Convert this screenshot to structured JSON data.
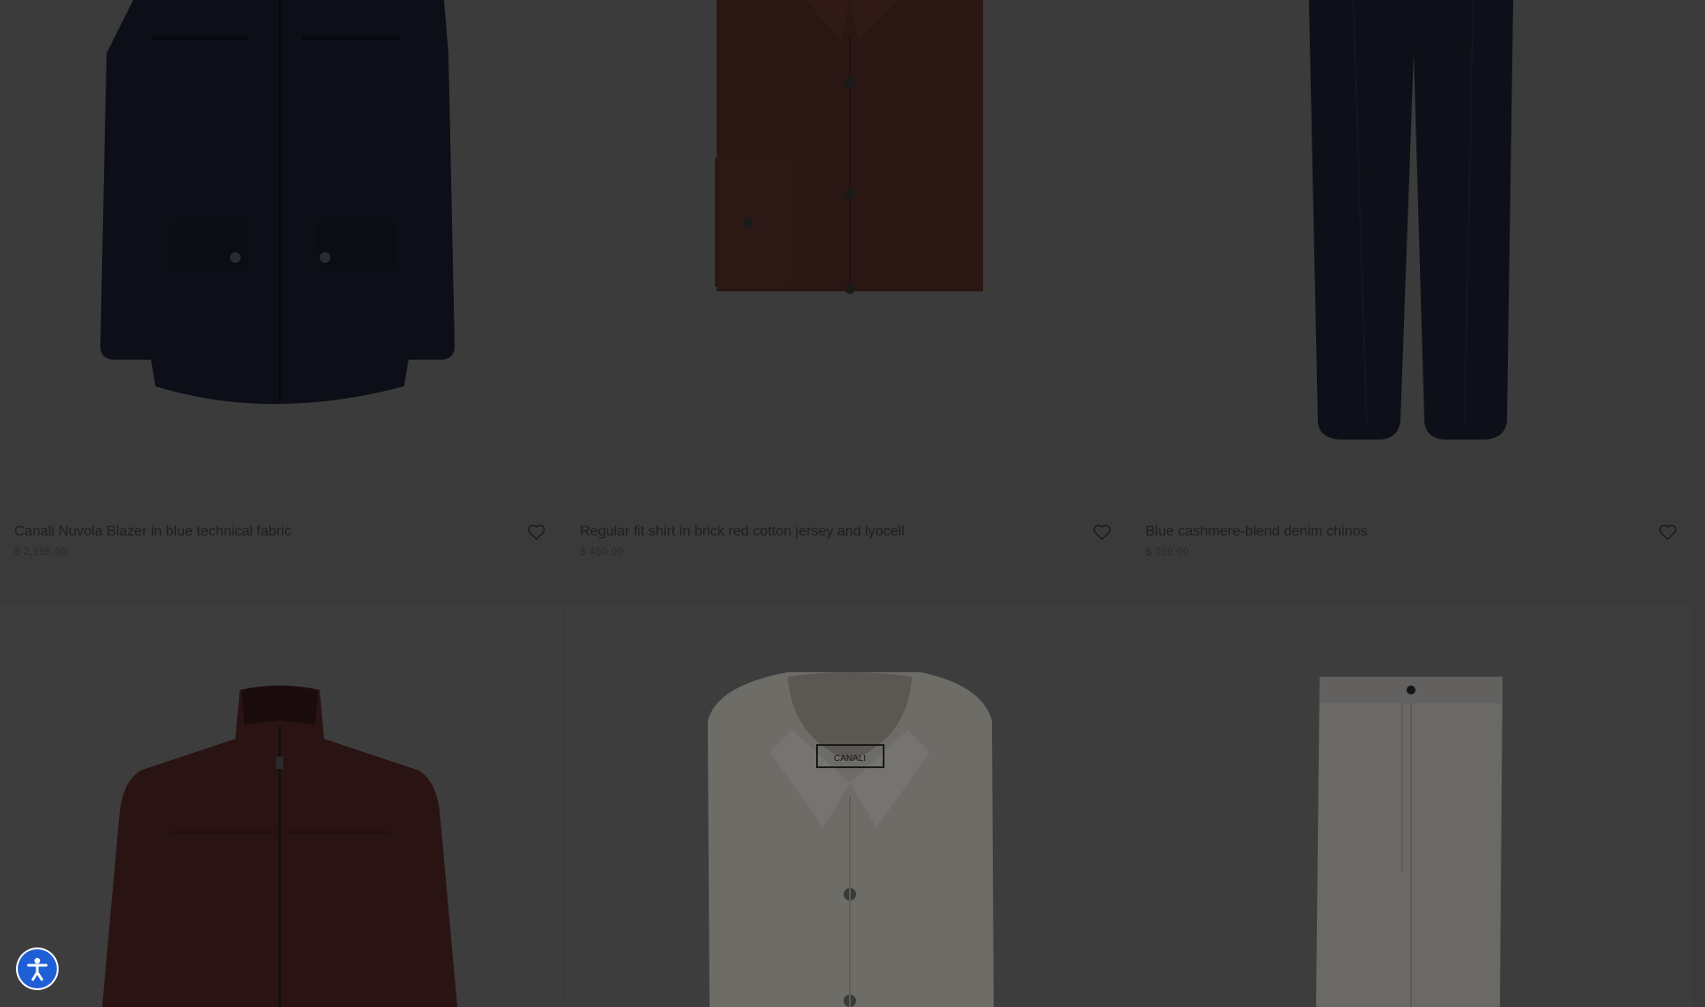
{
  "products": [
    {
      "name": "Canali Nuvola Blazer in blue technical fabric",
      "price": "$ 2,395.00",
      "image": "blue-blazer"
    },
    {
      "name": "Regular fit shirt in brick red cotton jersey and lyocell",
      "price": "$ 450.00",
      "image": "brick-red-shirt"
    },
    {
      "name": "Blue cashmere-blend denim chinos",
      "price": "$ 750.00",
      "image": "blue-chinos"
    }
  ],
  "lower_row_images": [
    "burgundy-bomber-jacket",
    "white-shirt",
    "white-trousers"
  ],
  "shirt_label": "CANALI",
  "wishlist_icon": "heart-icon",
  "accessibility_icon": "accessibility-person-icon",
  "colors": {
    "overlay_background": "#3a3a3a",
    "accessibility_button": "#1f5fd6"
  }
}
